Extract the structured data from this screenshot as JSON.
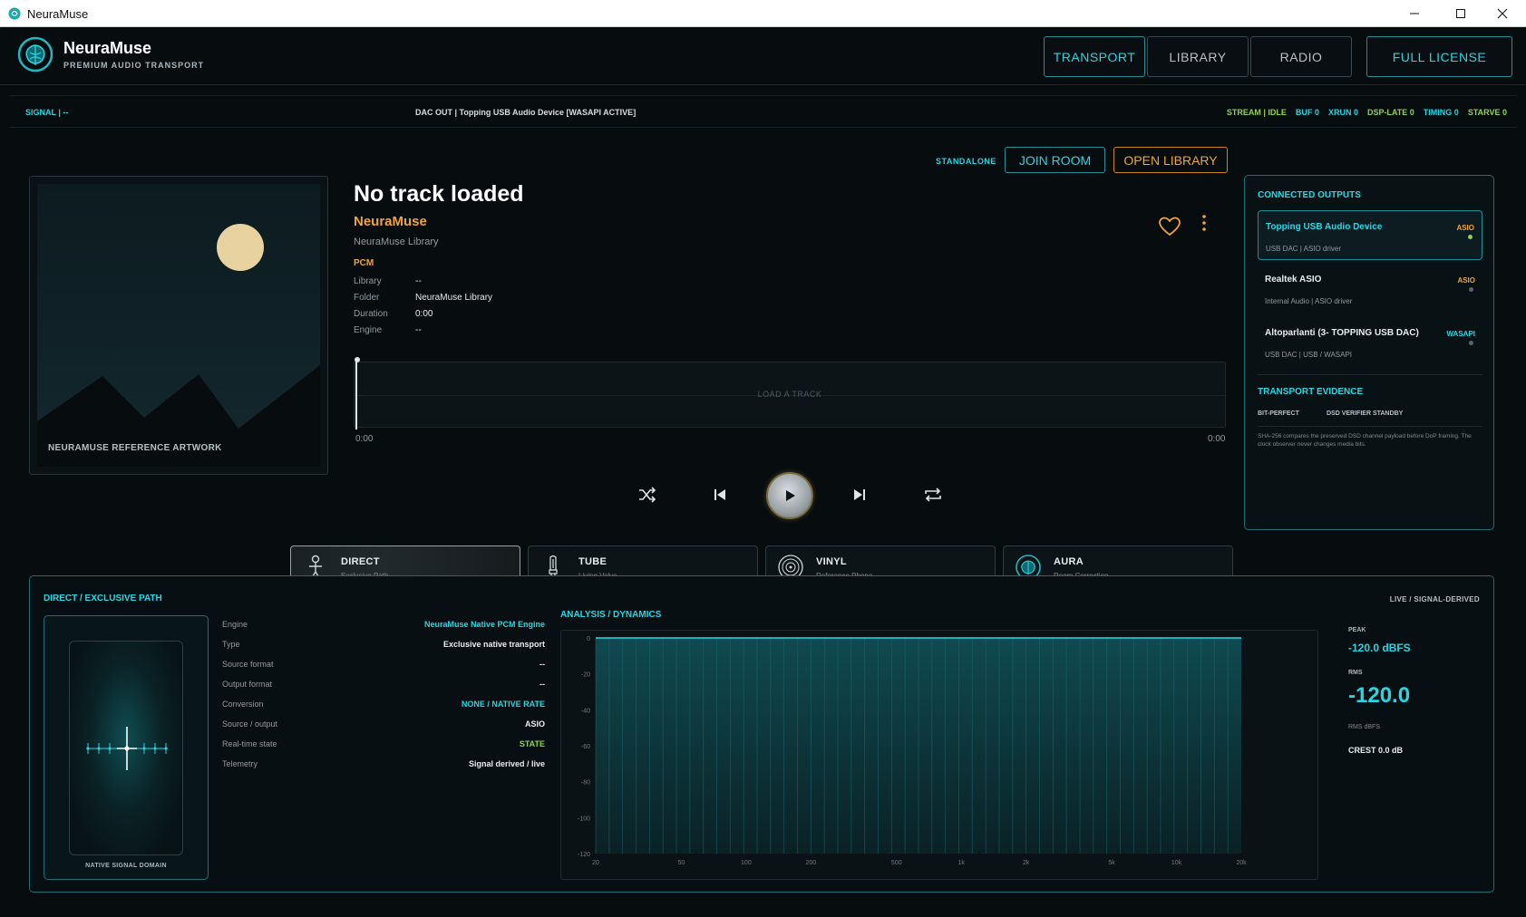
{
  "window": {
    "title": "NeuraMuse"
  },
  "brand": {
    "name": "NeuraMuse",
    "tagline": "PREMIUM AUDIO TRANSPORT"
  },
  "nav": {
    "transport": "TRANSPORT",
    "library": "LIBRARY",
    "radio": "RADIO",
    "license": "FULL LICENSE"
  },
  "status": {
    "signal": "SIGNAL  |  --",
    "dac": "DAC OUT  |  Topping USB Audio Device  [WASAPI ACTIVE]",
    "stream": "STREAM  |  IDLE",
    "buf": "BUF 0",
    "xrun": "XRUN 0",
    "dsp_late": "DSP-LATE 0",
    "timing": "TIMING 0",
    "starve": "STARVE 0"
  },
  "mode": {
    "standalone": "STANDALONE",
    "join_room": "JOIN ROOM",
    "open_library": "OPEN LIBRARY"
  },
  "artwork": {
    "label": "NEURAMUSE REFERENCE ARTWORK"
  },
  "track": {
    "title": "No track loaded",
    "artist": "NeuraMuse",
    "album": "NeuraMuse Library",
    "format": "PCM",
    "meta": [
      {
        "k": "Library",
        "v": "--"
      },
      {
        "k": "Folder",
        "v": "NeuraMuse Library"
      },
      {
        "k": "Duration",
        "v": "0:00"
      },
      {
        "k": "Engine",
        "v": "--"
      }
    ]
  },
  "waveform": {
    "placeholder": "LOAD A TRACK",
    "time_start": "0:00",
    "time_end": "0:00",
    "progress": 0
  },
  "dsp_modes": [
    {
      "name": "DIRECT",
      "sub": "Exclusive Path"
    },
    {
      "name": "TUBE",
      "sub": "Living Valve"
    },
    {
      "name": "VINYL",
      "sub": "Reference Phono"
    },
    {
      "name": "AURA",
      "sub": "Room Correction"
    }
  ],
  "outputs": {
    "title": "CONNECTED OUTPUTS",
    "items": [
      {
        "name": "Topping USB Audio Device",
        "desc": "USB DAC  |  ASIO driver",
        "tag": "ASIO",
        "tag_color": "#f0a43a",
        "status_color": "#8fd34e"
      },
      {
        "name": "Realtek ASIO",
        "desc": "Internal Audio  |  ASIO driver",
        "tag": "ASIO",
        "tag_color": "#f0a43a",
        "status_color": "#5b6468"
      },
      {
        "name": "Altoparlanti (3- TOPPING USB DAC)",
        "desc": "USB DAC  |  USB / WASAPI",
        "tag": "WASAPI",
        "tag_color": "#27d6e3",
        "status_color": "#5b6468"
      }
    ],
    "evidence_title": "TRANSPORT EVIDENCE",
    "evidence_bitperfect": "BIT-PERFECT",
    "evidence_dsd": "DSD VERIFIER STANDBY",
    "evidence_note": "SHA-256 compares the preserved DSD channel payload before DoP framing. The clock observer never changes media bits."
  },
  "bottom": {
    "title": "DIRECT / EXCLUSIVE PATH",
    "live": "LIVE / SIGNAL-DERIVED",
    "domain_label": "NATIVE SIGNAL DOMAIN",
    "engine_rows": [
      {
        "k": "Engine",
        "v": "NeuraMuse Native PCM Engine",
        "style": "cyan"
      },
      {
        "k": "Type",
        "v": "Exclusive native transport",
        "style": ""
      },
      {
        "k": "Source format",
        "v": "--",
        "style": ""
      },
      {
        "k": "Output format",
        "v": "--",
        "style": ""
      },
      {
        "k": "Conversion",
        "v": "NONE / NATIVE RATE",
        "style": "cyan"
      },
      {
        "k": "Source / output",
        "v": "ASIO",
        "style": ""
      },
      {
        "k": "Real-time state",
        "v": "STATE",
        "style": "green"
      },
      {
        "k": "Telemetry",
        "v": "Signal derived / live",
        "style": ""
      }
    ],
    "analysis_title": "ANALYSIS / DYNAMICS",
    "metrics": {
      "peak_label": "PEAK",
      "peak_value": "-120.0 dBFS",
      "rms_label": "RMS",
      "rms_value": "-120.0",
      "rms_unit": "RMS dBFS",
      "crest": "CREST   0.0 dB"
    }
  },
  "chart_data": {
    "type": "bar",
    "title": "",
    "xlabel": "",
    "ylabel": "",
    "y_ticks": [
      0,
      -20,
      -40,
      -60,
      -80,
      -100,
      -120
    ],
    "ylim": [
      -120,
      0
    ],
    "x_tick_labels": [
      "20",
      "50",
      "100",
      "200",
      "500",
      "1k",
      "2k",
      "5k",
      "10k",
      "20k"
    ],
    "x_scale": "log",
    "bin_count": 48,
    "values_db": -120,
    "accent": "#27d6e3"
  },
  "colors": {
    "accent": "#27d6e3",
    "amber": "#f0a43a",
    "green": "#8fd34e"
  }
}
